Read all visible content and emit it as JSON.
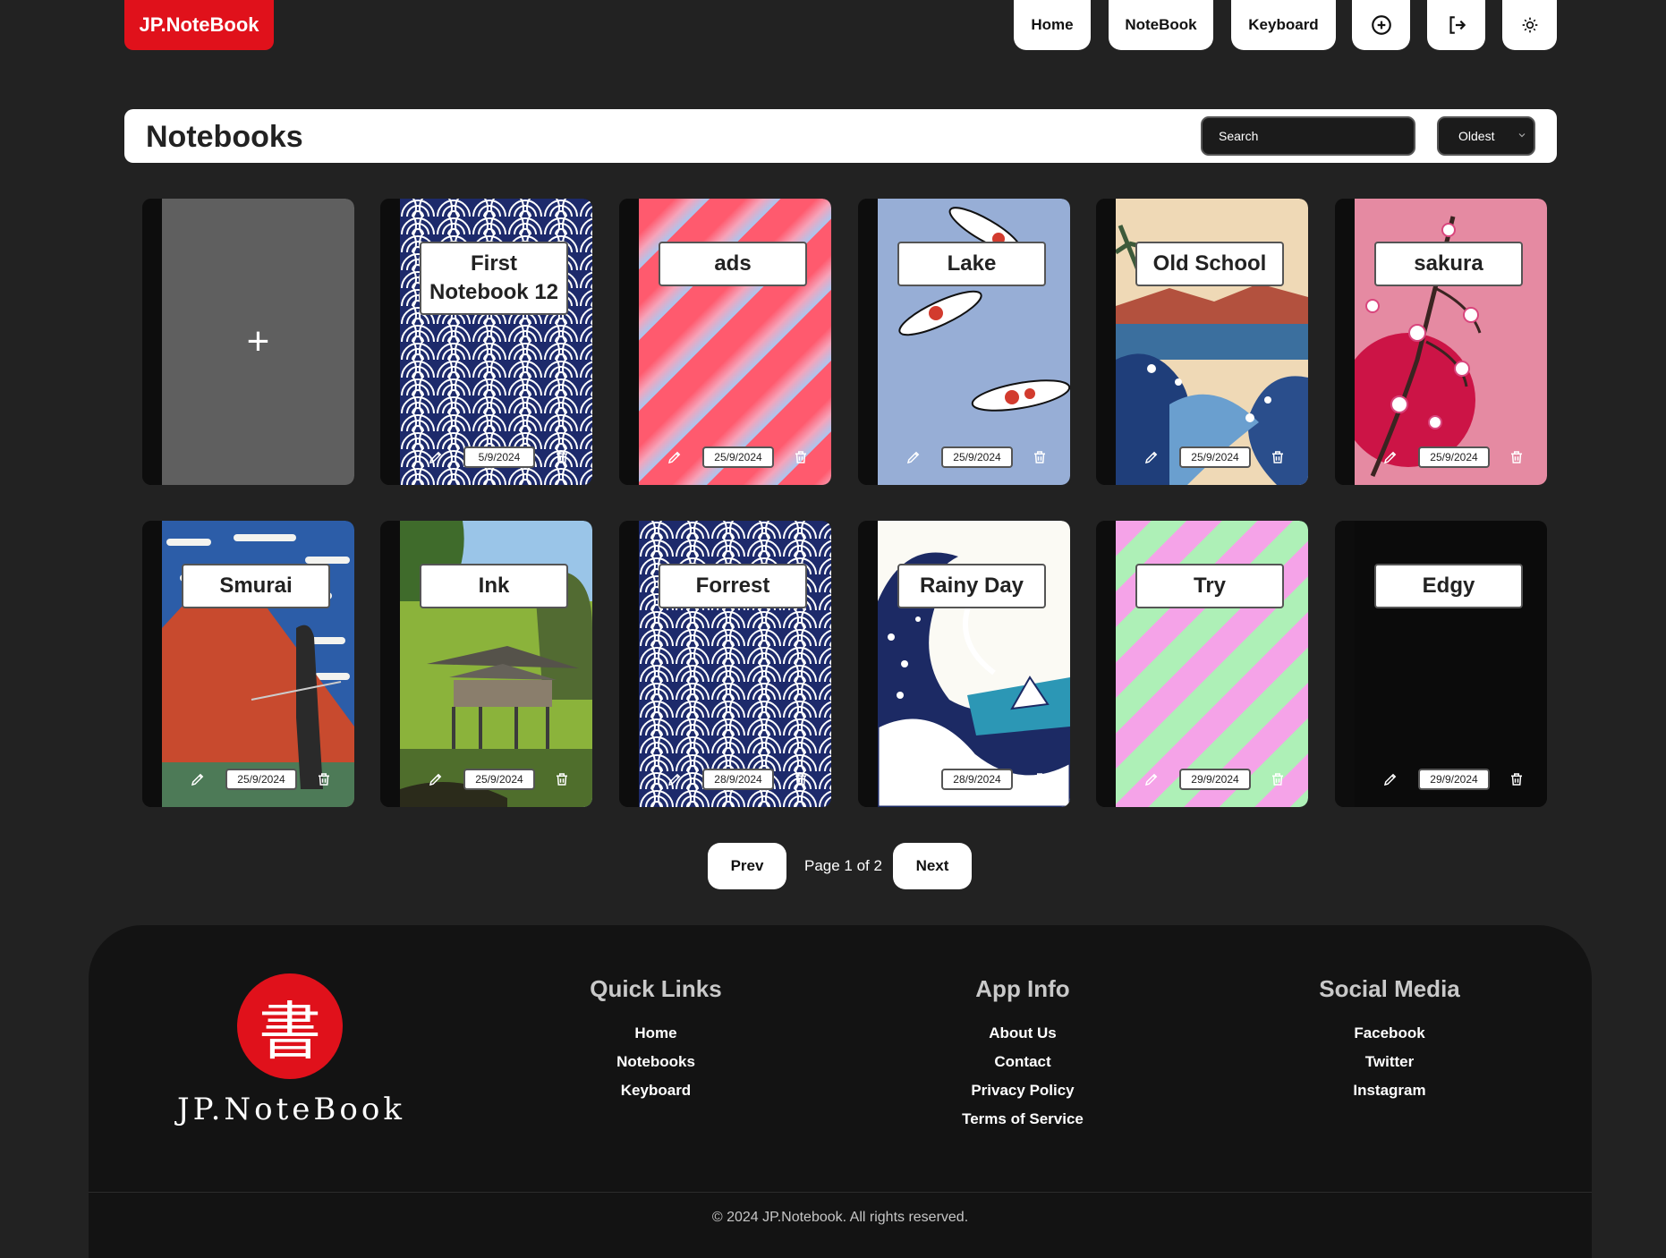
{
  "header": {
    "brand": "JP.NoteBook",
    "nav": [
      {
        "label": "Home"
      },
      {
        "label": "NoteBook"
      },
      {
        "label": "Keyboard"
      }
    ],
    "icons": [
      "plus-circle-icon",
      "logout-icon",
      "sun-icon"
    ]
  },
  "toolbar": {
    "title": "Notebooks",
    "search_placeholder": "Search",
    "sort_selected": "Oldest"
  },
  "notebooks": [
    {
      "title": "First Notebook 12",
      "date": "5/9/2024",
      "cover": "seigaiha-blue"
    },
    {
      "title": "ads",
      "date": "25/9/2024",
      "cover": "stripes-red-blue"
    },
    {
      "title": "Lake",
      "date": "25/9/2024",
      "cover": "koi-fish"
    },
    {
      "title": "Old School",
      "date": "25/9/2024",
      "cover": "wave-landscape"
    },
    {
      "title": "sakura",
      "date": "25/9/2024",
      "cover": "sakura-sun"
    },
    {
      "title": "Smurai",
      "date": "25/9/2024",
      "cover": "red-fuji-samurai"
    },
    {
      "title": "Ink",
      "date": "25/9/2024",
      "cover": "green-pavilion"
    },
    {
      "title": "Forrest",
      "date": "28/9/2024",
      "cover": "seigaiha-blue"
    },
    {
      "title": "Rainy Day",
      "date": "28/9/2024",
      "cover": "great-wave"
    },
    {
      "title": "Try",
      "date": "29/9/2024",
      "cover": "stripes-pink-green"
    },
    {
      "title": "Edgy",
      "date": "29/9/2024",
      "cover": "black"
    }
  ],
  "pagination": {
    "prev": "Prev",
    "info": "Page 1 of 2",
    "next": "Next"
  },
  "footer": {
    "logo_char": "書",
    "brand": "JP.NoteBook",
    "quick_links": {
      "heading": "Quick Links",
      "items": [
        "Home",
        "Notebooks",
        "Keyboard"
      ]
    },
    "app_info": {
      "heading": "App Info",
      "items": [
        "About Us",
        "Contact",
        "Privacy Policy",
        "Terms of Service"
      ]
    },
    "social": {
      "heading": "Social Media",
      "items": [
        "Facebook",
        "Twitter",
        "Instagram"
      ]
    },
    "copyright": "© 2024 JP.Notebook. All rights reserved."
  },
  "colors": {
    "brand_red": "#e0111b",
    "background": "#222222",
    "footer_bg": "#131313"
  }
}
